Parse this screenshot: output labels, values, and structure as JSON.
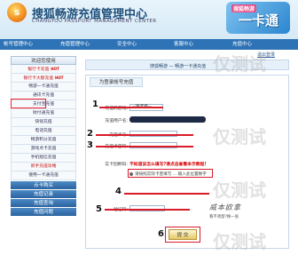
{
  "header": {
    "title": "搜狐畅游充值管理中心",
    "subtitle": "CHANGYOU PASSPORT MANAGEMENT CENTER",
    "promo_small": "搜狐畅游",
    "promo_big": "一卡通"
  },
  "nav": {
    "items": [
      "帐号管理中心",
      "充值管理中心",
      "安全中心",
      "客服中心",
      "充值中心"
    ]
  },
  "logout": "退出登录",
  "sidebar": {
    "head": "欢迎您使用",
    "items": [
      {
        "label": "银行卡充值",
        "tag": "HOT",
        "red": true
      },
      {
        "label": "银行卡大额充值",
        "tag": "HOT",
        "red": true
      },
      {
        "label": "畅游一卡通充值",
        "tag": "",
        "red": false
      },
      {
        "label": "通讯卡充值",
        "tag": "",
        "red": false
      },
      {
        "label": "支付宝充值",
        "tag": "",
        "red": false
      },
      {
        "label": "财付通充值",
        "tag": "",
        "red": false
      },
      {
        "label": "快钱充值",
        "tag": "",
        "red": false
      },
      {
        "label": "电话充值",
        "tag": "",
        "red": false
      },
      {
        "label": "畅游积分充值",
        "tag": "",
        "red": false
      },
      {
        "label": "游戏点卡充值",
        "tag": "",
        "red": false
      },
      {
        "label": "手机短信充值",
        "tag": "",
        "red": false
      },
      {
        "label": "新手充值攻略",
        "tag": "",
        "red": true
      },
      {
        "label": "使用一卡通充值",
        "tag": "",
        "red": false
      }
    ],
    "categories": [
      "点卡购买",
      "充值记录",
      "充值查询",
      "充值问题"
    ]
  },
  "breadcrumb": "搜狐畅游 — 畅游一卡通充值",
  "panel_tab": "为登录帐号充值",
  "form": {
    "game_label": "充值的游戏:",
    "game_value": "--请选择--",
    "account_label": "充值用户名:",
    "card_label": "充值卡号:",
    "password_label": "充值卡密码:",
    "code_label": "验证码:",
    "warn": "不知道该怎么填写?请点击查看本示教程!",
    "hint": "请按照实际卡密填写 ... 输入此位置数字",
    "captcha": "威本欧拿",
    "captcha_tip": "看不清楚?换一张",
    "submit": "提 交"
  },
  "steps": [
    "1",
    "2",
    "3",
    "4",
    "5",
    "6"
  ],
  "watermark": "仅测试"
}
